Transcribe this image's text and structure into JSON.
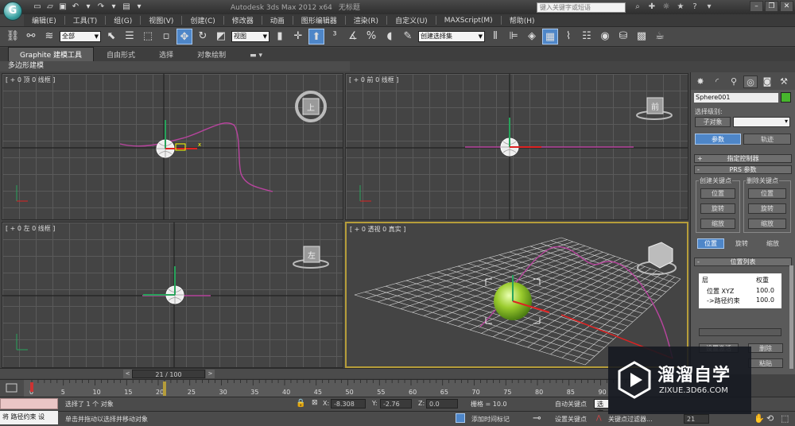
{
  "title_bar": {
    "app_logo_letter": "G",
    "app_name": "Autodesk 3ds Max  2012 x64",
    "doc_name": "无标题",
    "search_placeholder": "键入关键字或短语"
  },
  "menu": [
    "编辑(E)",
    "工具(T)",
    "组(G)",
    "视图(V)",
    "创建(C)",
    "修改器",
    "动画",
    "图形编辑器",
    "渲染(R)",
    "自定义(U)",
    "MAXScript(M)",
    "帮助(H)"
  ],
  "toolbar": {
    "selection_filter": "全部",
    "reference_coord": "视图",
    "named_selection": "创建选择集"
  },
  "ribbon": {
    "tabs": [
      "Graphite 建模工具",
      "自由形式",
      "选择",
      "对象绘制"
    ],
    "sub_label": "多边形建模"
  },
  "viewports": {
    "top": "[ + 0 顶 0 线框 ]",
    "front": "[ + 0 前 0 线框 ]",
    "left": "[ + 0 左 0 线框 ]",
    "persp": "[ + 0 透视 0 真实 ]",
    "viewcube_top": "上",
    "viewcube_front": "前",
    "viewcube_left": "左"
  },
  "command_panel": {
    "object_name": "Sphere001",
    "selection_level_label": "选择级别:",
    "sub_object_label": "子对象",
    "tab_params": "参数",
    "tab_track": "轨迹",
    "assign_controller": "指定控制器",
    "prs_params": "PRS 参数",
    "create_key_label": "创建关键点",
    "delete_key_label": "删除关键点",
    "create_keys": [
      "位置",
      "旋转",
      "缩放"
    ],
    "delete_keys": [
      "位置",
      "旋转",
      "缩放"
    ],
    "prs_tabs": [
      "位置",
      "旋转",
      "缩放"
    ],
    "position_list": "位置列表",
    "list_col_layer": "层",
    "list_col_weight": "权重",
    "list_rows": [
      {
        "layer": "位置 XYZ",
        "weight": "100.0"
      },
      {
        "layer": "->路径约束",
        "weight": "100.0"
      }
    ],
    "set_active": "设置激活",
    "delete_btn": "删除",
    "paste_btn": "粘贴"
  },
  "timeline": {
    "frame_display": "21 / 100",
    "ticks": [
      "0",
      "5",
      "10",
      "15",
      "20",
      "25",
      "30",
      "35",
      "40",
      "45",
      "50",
      "55",
      "60",
      "65",
      "70",
      "75",
      "80",
      "85",
      "90"
    ],
    "current_frame": 21,
    "total_frames": 100
  },
  "status": {
    "selection_info": "选择了 1 个 对象",
    "prompt": "单击并拖动以选择并移动对象",
    "x_value": "-8.308",
    "y_value": "-2.76",
    "z_value": "0.0",
    "grid": "栅格 = 10.0",
    "auto_key": "自动关键点",
    "selected_dropdown": "选定对",
    "set_key": "设置关键点",
    "key_filters": "关键点过滤器...",
    "add_time_tag": "添加时间标记",
    "frame_spinner": "21",
    "listener_text": "将 路径约束 设"
  },
  "watermark": {
    "title": "溜溜自学",
    "url": "ZIXUE.3D66.COM"
  },
  "colors": {
    "accent_blue": "#4e86c8",
    "object_green": "#47b62d",
    "path_magenta": "#b8449e",
    "active_viewport_border": "#b69d3a"
  }
}
